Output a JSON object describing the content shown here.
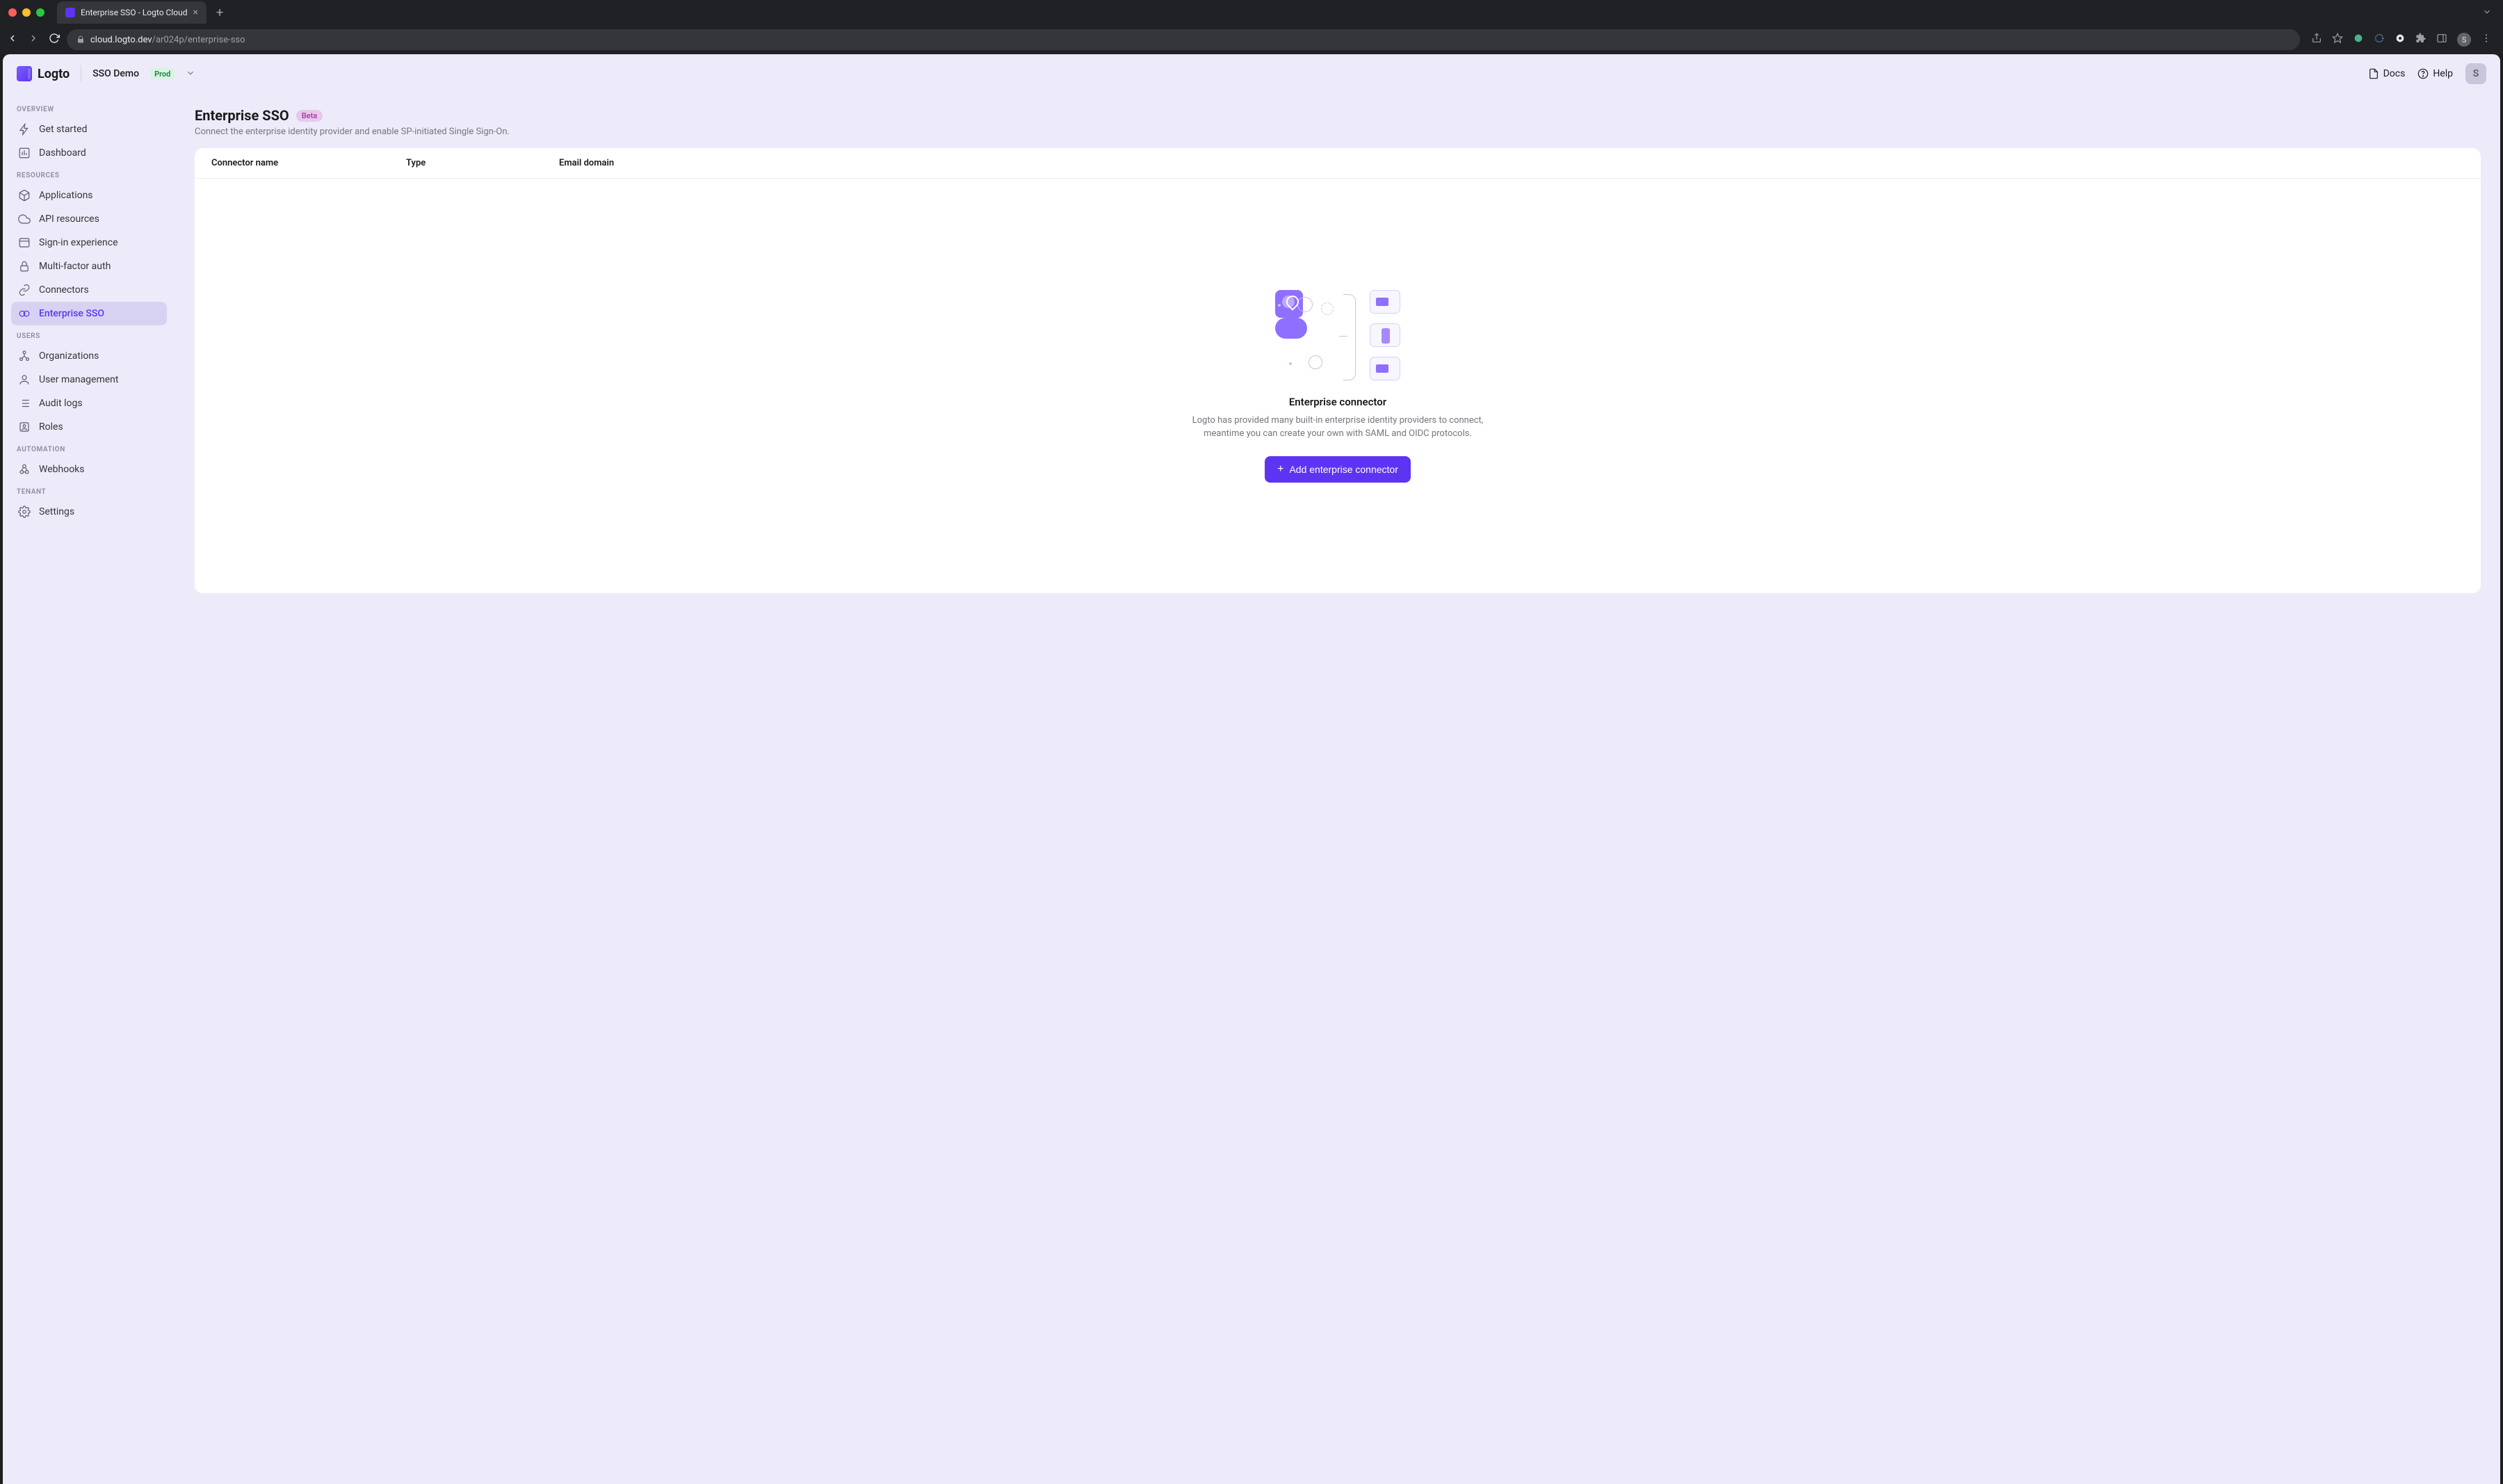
{
  "browser": {
    "tab_title": "Enterprise SSO - Logto Cloud",
    "url_prefix": "cloud.logto.dev",
    "url_path": "/ar024p/enterprise-sso"
  },
  "topbar": {
    "brand": "Logto",
    "tenant_name": "SSO Demo",
    "env_badge": "Prod",
    "docs_label": "Docs",
    "help_label": "Help",
    "avatar_initial": "S"
  },
  "sidebar": {
    "sections": {
      "overview": "OVERVIEW",
      "resources": "RESOURCES",
      "users": "USERS",
      "automation": "AUTOMATION",
      "tenant": "TENANT"
    },
    "items": {
      "get_started": "Get started",
      "dashboard": "Dashboard",
      "applications": "Applications",
      "api_resources": "API resources",
      "sign_in_experience": "Sign-in experience",
      "mfa": "Multi-factor auth",
      "connectors": "Connectors",
      "enterprise_sso": "Enterprise SSO",
      "organizations": "Organizations",
      "user_management": "User management",
      "audit_logs": "Audit logs",
      "roles": "Roles",
      "webhooks": "Webhooks",
      "settings": "Settings"
    }
  },
  "page": {
    "title": "Enterprise SSO",
    "badge": "Beta",
    "subtitle": "Connect the enterprise identity provider and enable SP-initiated Single Sign-On.",
    "columns": {
      "name": "Connector name",
      "type": "Type",
      "domain": "Email domain"
    },
    "empty": {
      "title": "Enterprise connector",
      "description": "Logto has provided many built-in enterprise identity providers to connect, meantime you can create your own with SAML and OIDC protocols.",
      "button": "Add enterprise connector"
    }
  }
}
